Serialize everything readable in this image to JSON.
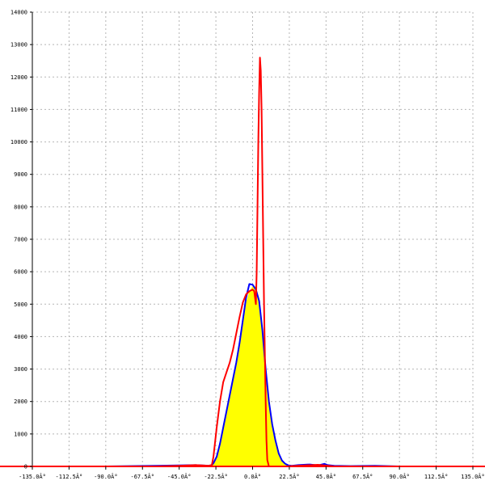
{
  "chart_data": {
    "type": "area",
    "title": "",
    "xlabel": "",
    "ylabel": "",
    "xlim": [
      -135,
      135
    ],
    "ylim": [
      0,
      14000
    ],
    "grid": true,
    "x_tick_values": [
      -135,
      -112.5,
      -90,
      -67.5,
      -45,
      -22.5,
      0,
      22.5,
      45,
      67.5,
      90,
      112.5,
      135
    ],
    "x_tick_labels": [
      "-135.0Â°",
      "-112.5Â°",
      "-90.0Â°",
      "-67.5Â°",
      "-45.0Â°",
      "-22.5Â°",
      "0.0Â°",
      "22.5Â°",
      "45.0Â°",
      "67.5Â°",
      "90.0Â°",
      "112.5Â°",
      "135.0Â°"
    ],
    "y_tick_values": [
      0,
      1000,
      2000,
      3000,
      4000,
      5000,
      6000,
      7000,
      8000,
      9000,
      10000,
      11000,
      12000,
      13000,
      14000
    ],
    "y_tick_labels": [
      "0",
      "1000",
      "2000",
      "3000",
      "4000",
      "5000",
      "6000",
      "7000",
      "8000",
      "9000",
      "10000",
      "11000",
      "12000",
      "13000",
      "14000"
    ],
    "series": [
      {
        "style": "filled-area",
        "fill": "#ffff00",
        "x": [
          -135,
          -90,
          -60,
          -45,
          -35,
          -27,
          -25,
          -24,
          -22,
          -20,
          -18,
          -16,
          -14,
          -12,
          -10,
          -8,
          -6,
          -4,
          -2,
          0,
          2,
          4,
          6,
          8,
          10,
          12,
          14,
          16,
          18,
          20,
          22,
          24,
          28,
          35,
          40,
          44,
          46,
          50,
          60,
          75,
          90
        ],
        "values": [
          0,
          0,
          20,
          30,
          40,
          20,
          40,
          100,
          300,
          700,
          1200,
          1700,
          2200,
          2700,
          3200,
          3800,
          4500,
          5050,
          5400,
          5550,
          5550,
          5200,
          4200,
          3000,
          2000,
          1300,
          800,
          400,
          180,
          80,
          30,
          20,
          40,
          60,
          30,
          80,
          40,
          20,
          10,
          20,
          0
        ]
      },
      {
        "style": "line",
        "color": "#0000ff",
        "x": [
          -135,
          -90,
          -60,
          -45,
          -35,
          -27,
          -25,
          -24,
          -22,
          -20,
          -18,
          -16,
          -14,
          -12,
          -10,
          -8,
          -6,
          -4,
          -2,
          0,
          2,
          4,
          6,
          8,
          10,
          12,
          14,
          16,
          18,
          20,
          22,
          24,
          28,
          35,
          40,
          44,
          46,
          50,
          60,
          75,
          90
        ],
        "values": [
          0,
          0,
          20,
          30,
          40,
          20,
          40,
          100,
          300,
          700,
          1200,
          1700,
          2200,
          2700,
          3200,
          3800,
          4500,
          5200,
          5620,
          5600,
          5450,
          5100,
          4200,
          3000,
          2000,
          1300,
          800,
          400,
          180,
          80,
          30,
          20,
          40,
          60,
          30,
          80,
          40,
          20,
          10,
          20,
          0
        ]
      },
      {
        "style": "line",
        "color": "#ff0000",
        "x": [
          -135,
          -60,
          -45,
          -35,
          -27,
          -25,
          -24,
          -22,
          -20,
          -18,
          -16,
          -14,
          -12,
          -10,
          -8,
          -6,
          -4,
          -2,
          0,
          1,
          2,
          2.5,
          3,
          3.5,
          4,
          4.5,
          5,
          5.5,
          6,
          6.5,
          7,
          8,
          8.5,
          9,
          10,
          20,
          40,
          50,
          90,
          135
        ],
        "values": [
          0,
          0,
          20,
          40,
          20,
          40,
          300,
          1200,
          2000,
          2600,
          2900,
          3200,
          3600,
          4100,
          4600,
          5050,
          5300,
          5400,
          5450,
          5400,
          5000,
          6000,
          8000,
          10000,
          11500,
          12600,
          12200,
          11000,
          9000,
          7000,
          5000,
          2000,
          800,
          200,
          0,
          0,
          50,
          0,
          0,
          0
        ]
      }
    ]
  }
}
